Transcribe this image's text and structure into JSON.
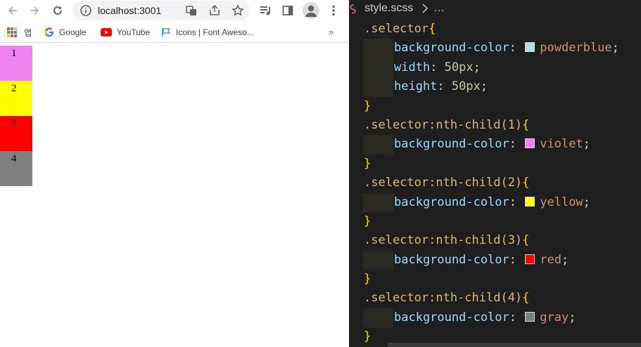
{
  "browser": {
    "url": "localhost:3001",
    "bookmarks": [
      {
        "label": "앱"
      },
      {
        "label": "Google"
      },
      {
        "label": "YouTube"
      },
      {
        "label": "Icons | Font Aweso..."
      }
    ],
    "bookmarks_more": "»",
    "selectors": [
      {
        "label": "1",
        "color": "#ee82ee"
      },
      {
        "label": "2",
        "color": "#ffff00"
      },
      {
        "label": "3",
        "color": "#ff0000"
      },
      {
        "label": "4",
        "color": "#808080"
      }
    ]
  },
  "editor": {
    "breadcrumb_file": "style.scss",
    "breadcrumb_more": "…",
    "colors": {
      "powderblue": "#b0e0e6",
      "violet": "#ee82ee",
      "yellow": "#ffff00",
      "red": "#ff0000",
      "gray": "#808080"
    },
    "lines": [
      {
        "sel": ".selector",
        "brace": "{"
      },
      {
        "prop": "background-color",
        "val": "powderblue",
        "swatch": "powderblue"
      },
      {
        "prop": "width",
        "num": "50px"
      },
      {
        "prop": "height",
        "num": "50px"
      },
      {
        "brace": "}"
      },
      {
        "sel": ".selector:nth-child(1)",
        "brace": "{"
      },
      {
        "prop": "background-color",
        "val": "violet",
        "swatch": "violet"
      },
      {
        "brace": "}"
      },
      {
        "sel": ".selector:nth-child(2)",
        "brace": "{"
      },
      {
        "prop": "background-color",
        "val": "yellow",
        "swatch": "yellow"
      },
      {
        "brace": "}"
      },
      {
        "sel": ".selector:nth-child(3)",
        "brace": "{"
      },
      {
        "prop": "background-color",
        "val": "red",
        "swatch": "red"
      },
      {
        "brace": "}"
      },
      {
        "sel": ".selector:nth-child(4)",
        "brace": "{"
      },
      {
        "prop": "background-color",
        "val": "gray",
        "swatch": "gray"
      },
      {
        "brace": "}"
      }
    ]
  }
}
